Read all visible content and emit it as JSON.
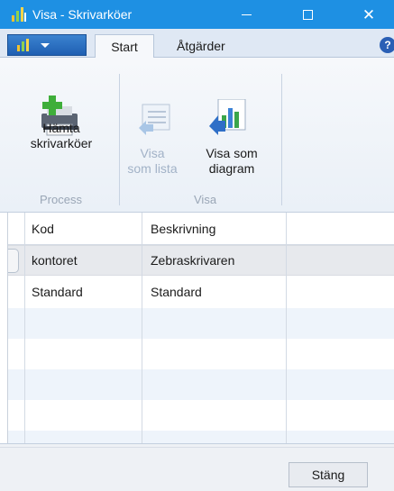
{
  "window": {
    "title": "Visa - Skrivarköer",
    "accent": "#1e90e3",
    "controls": [
      "minimize-icon",
      "maximize-icon",
      "close-icon"
    ]
  },
  "ribbon": {
    "tabs": [
      {
        "label": "Start",
        "active": true
      },
      {
        "label": "Åtgärder",
        "active": false
      }
    ],
    "groups": {
      "process": {
        "label": "Process",
        "buttons": [
          {
            "label_line1": "Hämta",
            "label_line2": "skrivarköer",
            "icon": "printer-add-icon",
            "enabled": true
          }
        ]
      },
      "visa": {
        "label": "Visa",
        "buttons": [
          {
            "label_line1": "Visa",
            "label_line2": "som lista",
            "icon": "list-view-icon",
            "enabled": false
          },
          {
            "label_line1": "Visa som",
            "label_line2": "diagram",
            "icon": "chart-view-icon",
            "enabled": true
          }
        ]
      }
    },
    "help_glyph": "?"
  },
  "grid": {
    "columns": [
      "Kod",
      "Beskrivning"
    ],
    "rows": [
      {
        "kod": "kontoret",
        "beskrivning": "Zebraskrivaren",
        "selected": true
      },
      {
        "kod": "Standard",
        "beskrivning": "Standard",
        "selected": false
      }
    ]
  },
  "footer": {
    "close_label": "Stäng"
  }
}
